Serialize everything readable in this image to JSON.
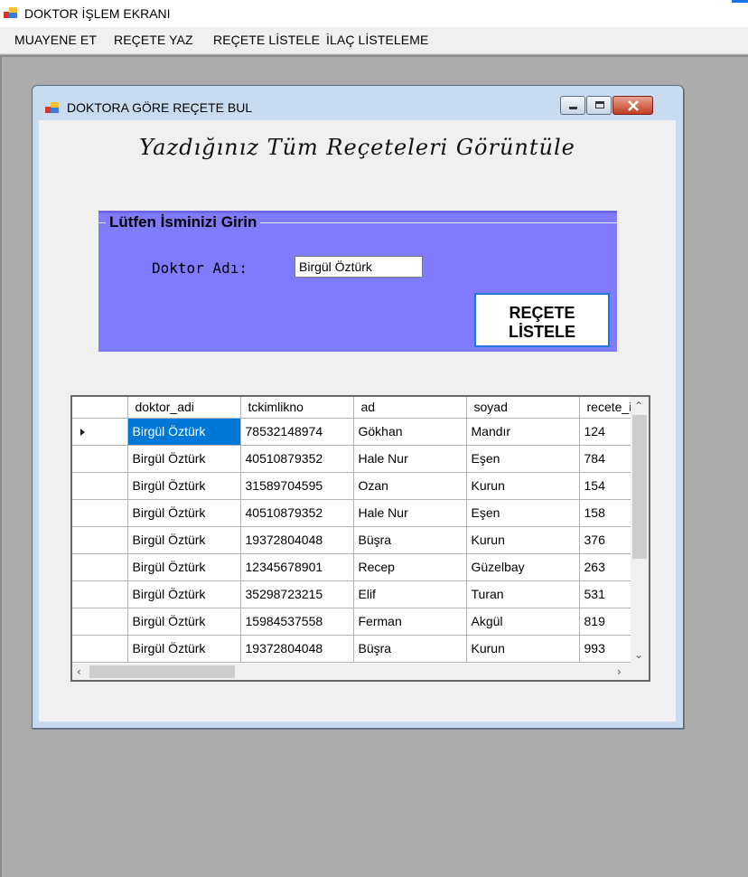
{
  "app": {
    "title": "DOKTOR İŞLEM EKRANI",
    "menu": [
      "MUAYENE ET",
      "REÇETE YAZ",
      "REÇETE LİSTELE",
      "İLAÇ LİSTELEME"
    ]
  },
  "child": {
    "title": "DOKTORA GÖRE REÇETE BUL",
    "heading": "Yazdığınız Tüm Reçeteleri Görüntüle",
    "group_title": "Lütfen İsminizi Girin",
    "doktor_label": "Doktor Adı:",
    "doktor_value": "Birgül Öztürk",
    "list_button": "REÇETE\nLİSTELE"
  },
  "grid": {
    "columns": [
      "doktor_adi",
      "tckimlikno",
      "ad",
      "soyad",
      "recete_i"
    ],
    "rows": [
      [
        "Birgül Öztürk",
        "78532148974",
        "Gökhan",
        "Mandır",
        "124"
      ],
      [
        "Birgül Öztürk",
        "40510879352",
        "Hale Nur",
        "Eşen",
        "784"
      ],
      [
        "Birgül Öztürk",
        "31589704595",
        "Ozan",
        "Kurun",
        "154"
      ],
      [
        "Birgül Öztürk",
        "40510879352",
        "Hale Nur",
        "Eşen",
        "158"
      ],
      [
        "Birgül Öztürk",
        "19372804048",
        "Büşra",
        "Kurun",
        "376"
      ],
      [
        "Birgül Öztürk",
        "12345678901",
        "Recep",
        "Güzelbay",
        "263"
      ],
      [
        "Birgül Öztürk",
        "35298723215",
        "Elif",
        "Turan",
        "531"
      ],
      [
        "Birgül Öztürk",
        "15984537558",
        "Ferman",
        "Akgül",
        "819"
      ],
      [
        "Birgül Öztürk",
        "19372804048",
        "Büşra",
        "Kurun",
        "993"
      ]
    ]
  },
  "colors": {
    "group_bg": "#7f7bfb",
    "selection": "#0078d7",
    "button_border": "#1e78d7"
  }
}
